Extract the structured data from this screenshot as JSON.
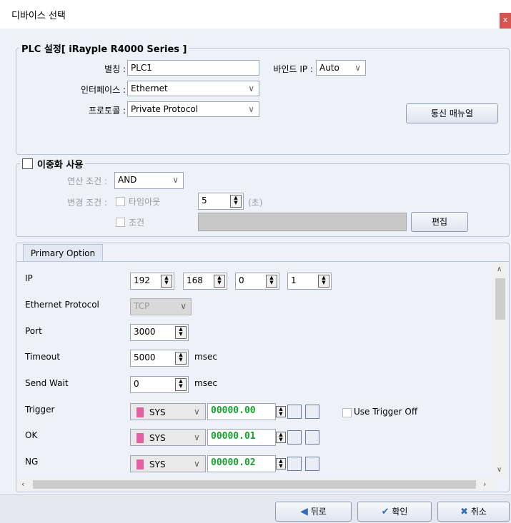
{
  "window": {
    "title": "디바이스 선택",
    "close_label": "x"
  },
  "plc_group": {
    "title": "PLC 설정[ iRayple R4000 Series ]",
    "alias_label": "별칭 :",
    "alias_value": "PLC1",
    "bind_ip_label": "바인드 IP :",
    "bind_ip_value": "Auto",
    "interface_label": "인터페이스 :",
    "interface_value": "Ethernet",
    "protocol_label": "프로토콜 :",
    "protocol_value": "Private Protocol",
    "manual_button": "통신 매뉴얼"
  },
  "redundancy_group": {
    "title": "이중화 사용",
    "checked": false,
    "op_condition_label": "연산 조건 :",
    "op_condition_value": "AND",
    "change_condition_label": "변경 조건 :",
    "timeout_label": "타임아웃",
    "timeout_value": "5",
    "timeout_unit": "(초)",
    "condition_label": "조건",
    "edit_button": "편집"
  },
  "primary_option": {
    "tab_label": "Primary Option",
    "ip_label": "IP",
    "ip_octets": [
      "192",
      "168",
      "0",
      "1"
    ],
    "eth_protocol_label": "Ethernet Protocol",
    "eth_protocol_value": "TCP",
    "port_label": "Port",
    "port_value": "3000",
    "timeout_label": "Timeout",
    "timeout_value": "5000",
    "timeout_unit": "msec",
    "send_wait_label": "Send Wait",
    "send_wait_value": "0",
    "send_wait_unit": "msec",
    "trigger": {
      "label": "Trigger",
      "device": "SYS",
      "address": "00000.00"
    },
    "use_trigger_off_label": "Use Trigger Off",
    "ok": {
      "label": "OK",
      "device": "SYS",
      "address": "00000.01"
    },
    "ng": {
      "label": "NG",
      "device": "SYS",
      "address": "00000.02"
    }
  },
  "footer": {
    "back_label": "뒤로",
    "ok_label": "확인",
    "cancel_label": "취소"
  },
  "colors": {
    "accent_green": "#14a32d",
    "device_marker": "#e55ea1",
    "close_red": "#d9534f"
  }
}
